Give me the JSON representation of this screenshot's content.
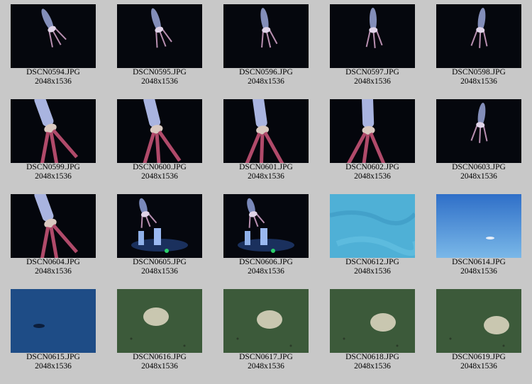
{
  "thumbnails": [
    {
      "file": "DSCN0594.JPG",
      "dims": "2048x1536",
      "scene": "squid-dark"
    },
    {
      "file": "DSCN0595.JPG",
      "dims": "2048x1536",
      "scene": "squid-dark"
    },
    {
      "file": "DSCN0596.JPG",
      "dims": "2048x1536",
      "scene": "squid-dark"
    },
    {
      "file": "DSCN0597.JPG",
      "dims": "2048x1536",
      "scene": "squid-dark"
    },
    {
      "file": "DSCN0598.JPG",
      "dims": "2048x1536",
      "scene": "squid-dark"
    },
    {
      "file": "DSCN0599.JPG",
      "dims": "2048x1536",
      "scene": "squid-close"
    },
    {
      "file": "DSCN0600.JPG",
      "dims": "2048x1536",
      "scene": "squid-close"
    },
    {
      "file": "DSCN0601.JPG",
      "dims": "2048x1536",
      "scene": "squid-close"
    },
    {
      "file": "DSCN0602.JPG",
      "dims": "2048x1536",
      "scene": "squid-close"
    },
    {
      "file": "DSCN0603.JPG",
      "dims": "2048x1536",
      "scene": "squid-dark"
    },
    {
      "file": "DSCN0604.JPG",
      "dims": "2048x1536",
      "scene": "squid-close"
    },
    {
      "file": "DSCN0605.JPG",
      "dims": "2048x1536",
      "scene": "squid-equipment"
    },
    {
      "file": "DSCN0606.JPG",
      "dims": "2048x1536",
      "scene": "squid-equipment"
    },
    {
      "file": "DSCN0612.JPG",
      "dims": "2048x1536",
      "scene": "seafloor-light"
    },
    {
      "file": "DSCN0614.JPG",
      "dims": "2048x1536",
      "scene": "seafloor-blue"
    },
    {
      "file": "DSCN0615.JPG",
      "dims": "2048x1536",
      "scene": "seafloor-deep"
    },
    {
      "file": "DSCN0616.JPG",
      "dims": "2048x1536",
      "scene": "seafloor-green"
    },
    {
      "file": "DSCN0617.JPG",
      "dims": "2048x1536",
      "scene": "seafloor-green"
    },
    {
      "file": "DSCN0618.JPG",
      "dims": "2048x1536",
      "scene": "seafloor-green"
    },
    {
      "file": "DSCN0619.JPG",
      "dims": "2048x1536",
      "scene": "seafloor-green"
    }
  ],
  "colors": {
    "page_background": "#c8c8c8",
    "caption_text": "#000000"
  }
}
